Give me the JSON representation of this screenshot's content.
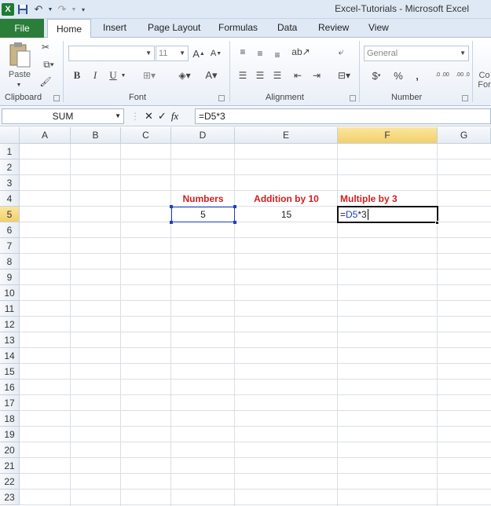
{
  "titlebar": {
    "title": "Excel-Tutorials  -  Microsoft Excel",
    "icons": [
      "excel-logo-icon",
      "save-icon",
      "undo-icon",
      "redo-icon",
      "customize-qat-icon"
    ]
  },
  "ribbon_tabs": [
    "File",
    "Home",
    "Insert",
    "Page Layout",
    "Formulas",
    "Data",
    "Review",
    "View"
  ],
  "ribbon": {
    "clipboard": {
      "paste_label": "Paste",
      "group_label": "Clipboard"
    },
    "font": {
      "font_name": "",
      "font_size": "11",
      "bold": "B",
      "italic": "I",
      "underline": "U",
      "group_label": "Font"
    },
    "alignment": {
      "group_label": "Alignment"
    },
    "number": {
      "format": "General",
      "currency": "$",
      "percent": "%",
      "comma": ",",
      "inc_decimal": ".0 .00",
      "dec_decimal": ".00 .0",
      "group_label": "Number"
    },
    "styles_partial": {
      "label_top": "Co",
      "label_bottom": "For"
    }
  },
  "formula_bar": {
    "name_box": "SUM",
    "cancel": "✕",
    "enter": "✓",
    "fx": "fx",
    "formula": "=D5*3"
  },
  "columns": [
    "A",
    "B",
    "C",
    "D",
    "E",
    "F",
    "G"
  ],
  "rows": [
    "1",
    "2",
    "3",
    "4",
    "5",
    "6",
    "7",
    "8",
    "9",
    "10",
    "11",
    "12",
    "13",
    "14",
    "15",
    "16",
    "17",
    "18",
    "19",
    "20",
    "21",
    "22",
    "23"
  ],
  "cells": {
    "D4": "Numbers",
    "E4": "Addition by 10",
    "F4": "Multiple by 3",
    "D5": "5",
    "E5": "15",
    "F5_prefix": "=",
    "F5_ref": "D5",
    "F5_suffix": "*3"
  },
  "colors": {
    "header_red": "#d21e1e",
    "ref_blue": "#1a3fbf",
    "active_header": "#f2cf6a",
    "file_tab": "#2b7d3a"
  }
}
